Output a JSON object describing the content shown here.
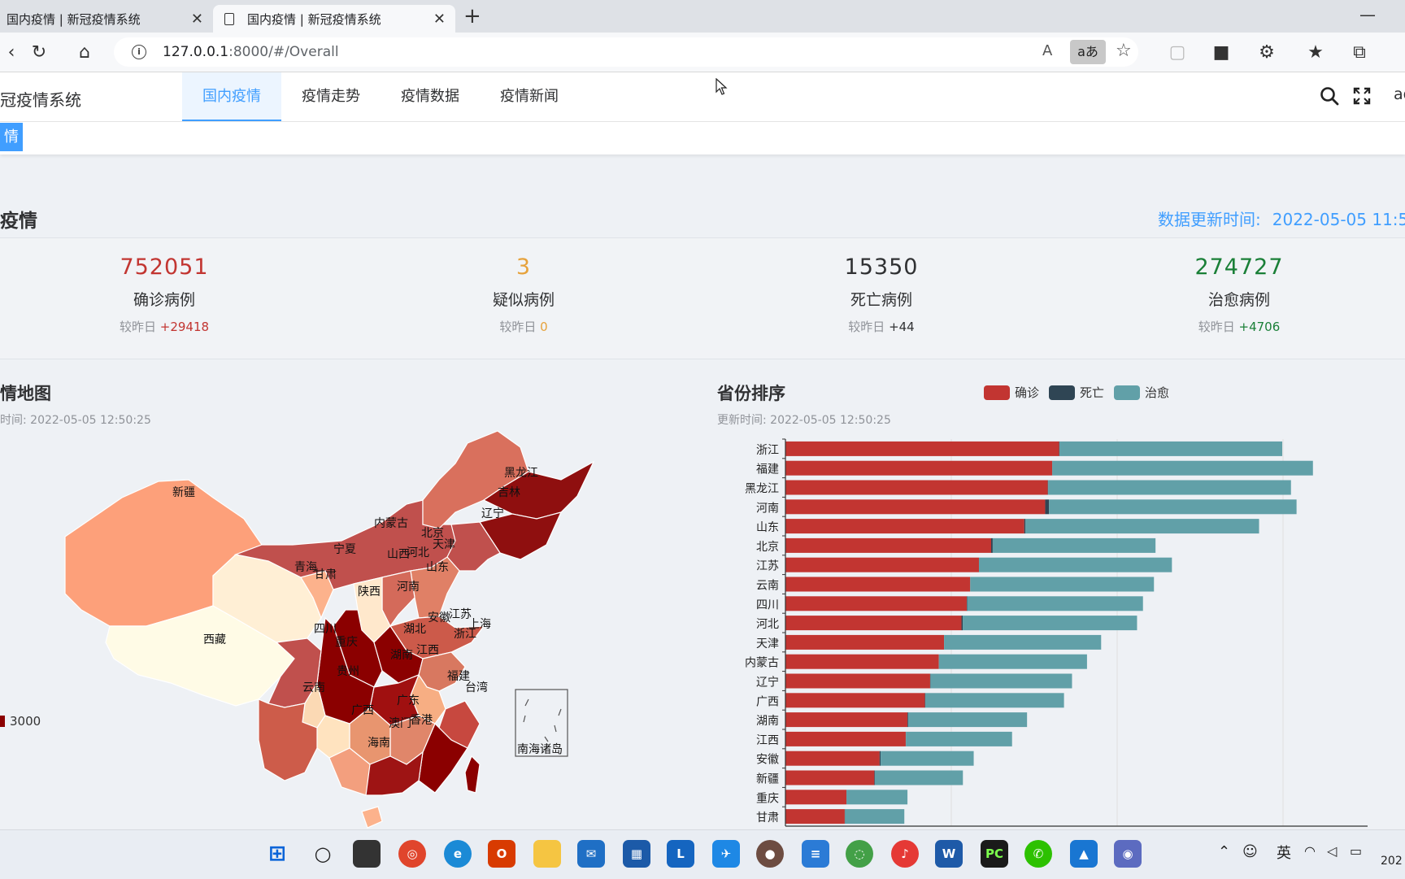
{
  "browser": {
    "tabs": [
      {
        "title": "国内疫情 | 新冠疫情系统",
        "active": false
      },
      {
        "title": "国内疫情 | 新冠疫情系统",
        "active": true
      }
    ],
    "url_host": "127.0.0.1",
    "url_rest": ":8000/#/Overall",
    "translate_label": "aあ"
  },
  "header": {
    "brand": "冠疫情系统",
    "nav": [
      "国内疫情",
      "疫情走势",
      "疫情数据",
      "疫情新闻"
    ],
    "active_nav": "国内疫情",
    "user": "ad",
    "active_tag": "情"
  },
  "summary": {
    "title": "疫情",
    "update_label": "数据更新时间:",
    "update_value": "2022-05-05 11:5",
    "stats": [
      {
        "value": "752051",
        "label": "确诊病例",
        "change_label": "较昨日",
        "change": "+29418",
        "color": "#c23531"
      },
      {
        "value": "3",
        "label": "疑似病例",
        "change_label": "较昨日",
        "change": "0",
        "color": "#e6a23c"
      },
      {
        "value": "15350",
        "label": "死亡病例",
        "change_label": "较昨日",
        "change": "+44",
        "color": "#303133"
      },
      {
        "value": "274727",
        "label": "治愈病例",
        "change_label": "较昨日",
        "change": "+4706",
        "color": "#1a7f37"
      }
    ]
  },
  "map_panel": {
    "title": "情地图",
    "subtitle": "时间: 2022-05-05 12:50:25",
    "visualmap_label": "3000",
    "south_sea_label": "南海诸岛"
  },
  "rank_panel": {
    "title": "省份排序",
    "subtitle": "更新时间: 2022-05-05 12:50:25",
    "legend": [
      {
        "name": "确诊",
        "color": "#c23531"
      },
      {
        "name": "死亡",
        "color": "#2f4554"
      },
      {
        "name": "治愈",
        "color": "#61a0a8"
      }
    ]
  },
  "chart_data": {
    "type": "bar",
    "orientation": "horizontal",
    "stacked": true,
    "categories": [
      "浙江",
      "福建",
      "黑龙江",
      "河南",
      "山东",
      "北京",
      "江苏",
      "云南",
      "四川",
      "河北",
      "天津",
      "内蒙古",
      "辽宁",
      "广西",
      "湖南",
      "江西",
      "安徽",
      "新疆",
      "重庆",
      "甘肃"
    ],
    "series": [
      {
        "name": "确诊",
        "values": [
          1570,
          1530,
          1505,
          1490,
          1370,
          1180,
          1110,
          1060,
          1040,
          1010,
          910,
          880,
          830,
          800,
          700,
          690,
          540,
          510,
          350,
          340
        ]
      },
      {
        "name": "死亡",
        "values": [
          2,
          1,
          2,
          22,
          7,
          9,
          0,
          0,
          3,
          7,
          0,
          0,
          2,
          2,
          4,
          1,
          6,
          3,
          0,
          2
        ]
      },
      {
        "name": "治愈",
        "values": [
          1278,
          1495,
          1393,
          1420,
          1340,
          934,
          1107,
          1054,
          1008,
          1000,
          901,
          850,
          812,
          796,
          682,
          609,
          534,
          505,
          350,
          340
        ]
      }
    ]
  },
  "taskbar": {
    "tray_text": "英",
    "clock": "202"
  }
}
